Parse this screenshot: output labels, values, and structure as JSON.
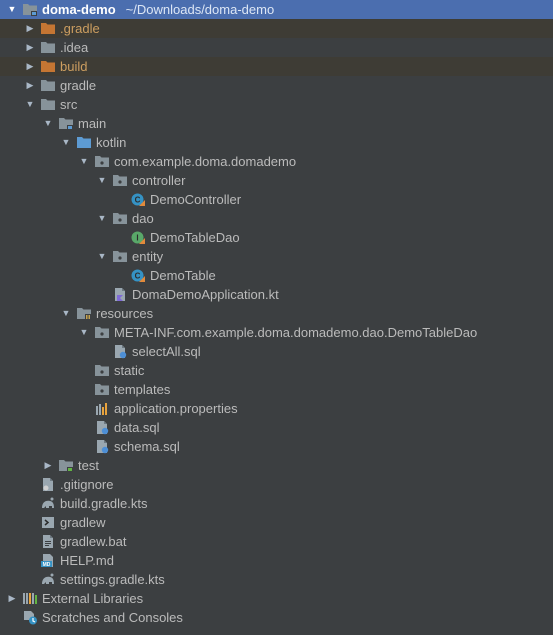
{
  "project_tree": {
    "rows": [
      {
        "label": "doma-demo",
        "path": "~/Downloads/doma-demo",
        "depth": 0,
        "state": "expanded",
        "icon": "module-folder-icon",
        "selected": true
      },
      {
        "label": ".gradle",
        "depth": 1,
        "state": "collapsed",
        "icon": "excluded-folder-icon",
        "excluded": true
      },
      {
        "label": ".idea",
        "depth": 1,
        "state": "collapsed",
        "icon": "folder-icon"
      },
      {
        "label": "build",
        "depth": 1,
        "state": "collapsed",
        "icon": "excluded-folder-icon",
        "excluded": true
      },
      {
        "label": "gradle",
        "depth": 1,
        "state": "collapsed",
        "icon": "folder-icon"
      },
      {
        "label": "src",
        "depth": 1,
        "state": "expanded",
        "icon": "folder-icon"
      },
      {
        "label": "main",
        "depth": 2,
        "state": "expanded",
        "icon": "source-root-folder-icon"
      },
      {
        "label": "kotlin",
        "depth": 3,
        "state": "expanded",
        "icon": "kotlin-source-folder-icon"
      },
      {
        "label": "com.example.doma.domademo",
        "depth": 4,
        "state": "expanded",
        "icon": "package-icon"
      },
      {
        "label": "controller",
        "depth": 5,
        "state": "expanded",
        "icon": "package-icon"
      },
      {
        "label": "DemoController",
        "depth": 6,
        "state": "leaf",
        "icon": "kotlin-class-icon"
      },
      {
        "label": "dao",
        "depth": 5,
        "state": "expanded",
        "icon": "package-icon"
      },
      {
        "label": "DemoTableDao",
        "depth": 6,
        "state": "leaf",
        "icon": "kotlin-interface-icon"
      },
      {
        "label": "entity",
        "depth": 5,
        "state": "expanded",
        "icon": "package-icon"
      },
      {
        "label": "DemoTable",
        "depth": 6,
        "state": "leaf",
        "icon": "kotlin-class-icon"
      },
      {
        "label": "DomaDemoApplication.kt",
        "depth": 5,
        "state": "leaf",
        "icon": "kotlin-file-icon"
      },
      {
        "label": "resources",
        "depth": 3,
        "state": "expanded",
        "icon": "resources-folder-icon"
      },
      {
        "label": "META-INF.com.example.doma.domademo.dao.DemoTableDao",
        "depth": 4,
        "state": "expanded",
        "icon": "package-icon"
      },
      {
        "label": "selectAll.sql",
        "depth": 5,
        "state": "leaf",
        "icon": "sql-file-icon"
      },
      {
        "label": "static",
        "depth": 4,
        "state": "leaf",
        "icon": "package-icon"
      },
      {
        "label": "templates",
        "depth": 4,
        "state": "leaf",
        "icon": "package-icon"
      },
      {
        "label": "application.properties",
        "depth": 4,
        "state": "leaf",
        "icon": "properties-file-icon"
      },
      {
        "label": "data.sql",
        "depth": 4,
        "state": "leaf",
        "icon": "sql-file-icon"
      },
      {
        "label": "schema.sql",
        "depth": 4,
        "state": "leaf",
        "icon": "sql-file-icon"
      },
      {
        "label": "test",
        "depth": 2,
        "state": "collapsed",
        "icon": "test-folder-icon"
      },
      {
        "label": ".gitignore",
        "depth": 1,
        "state": "leaf",
        "icon": "gitignore-file-icon"
      },
      {
        "label": "build.gradle.kts",
        "depth": 1,
        "state": "leaf",
        "icon": "gradle-file-icon"
      },
      {
        "label": "gradlew",
        "depth": 1,
        "state": "leaf",
        "icon": "shell-script-icon"
      },
      {
        "label": "gradlew.bat",
        "depth": 1,
        "state": "leaf",
        "icon": "text-file-icon"
      },
      {
        "label": "HELP.md",
        "depth": 1,
        "state": "leaf",
        "icon": "markdown-file-icon"
      },
      {
        "label": "settings.gradle.kts",
        "depth": 1,
        "state": "leaf",
        "icon": "gradle-file-icon"
      },
      {
        "label": "External Libraries",
        "depth": 0,
        "state": "collapsed",
        "icon": "libraries-icon"
      },
      {
        "label": "Scratches and Consoles",
        "depth": 0,
        "state": "leaf",
        "icon": "scratches-icon"
      }
    ]
  },
  "colors": {
    "background": "#3c3f41",
    "selection": "#4b6eaf",
    "excluded_row": "#3e3c35",
    "folder": "#87939a",
    "excluded_folder": "#c57633",
    "source_folder": "#5d9bd3",
    "kotlin_class": "#3592c4",
    "kotlin_interface": "#59a869",
    "properties_bars": "#e8a33d"
  }
}
